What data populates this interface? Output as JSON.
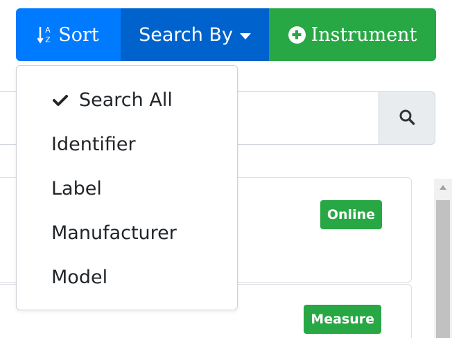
{
  "toolbar": {
    "sort_label": "Sort",
    "sort_icon": "sort-alpha-down-icon",
    "search_by_label": "Search By",
    "search_by_icon": "caret-down-icon",
    "instrument_label": "Instrument",
    "instrument_icon": "plus-circle-icon"
  },
  "search": {
    "value": "",
    "placeholder": "",
    "button_icon": "search-icon"
  },
  "dropdown": {
    "items": [
      {
        "label": "Search All",
        "selected": true,
        "icon": "check-icon"
      },
      {
        "label": "Identifier",
        "selected": false
      },
      {
        "label": "Label",
        "selected": false
      },
      {
        "label": "Manufacturer",
        "selected": false
      },
      {
        "label": "Model",
        "selected": false
      }
    ]
  },
  "cards": [
    {
      "badge": "Online"
    },
    {
      "badge": "Measure"
    }
  ],
  "colors": {
    "primary": "#007bff",
    "primary_active": "#0062cc",
    "success": "#28a745"
  }
}
